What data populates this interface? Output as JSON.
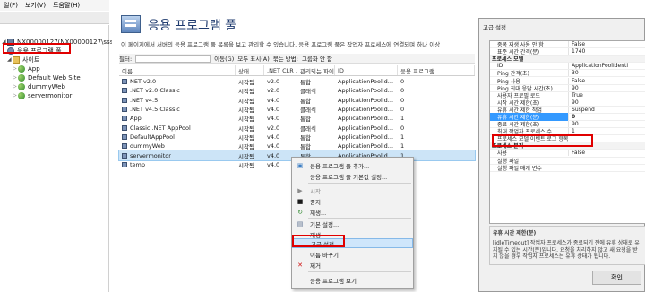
{
  "menu": [
    "일(F)",
    "보기(V)",
    "도움말(H)"
  ],
  "tree": {
    "server": "NX00000127(NX00000127\\sssss)",
    "app_pools": "응용 프로그램 풀",
    "sites": "사이트",
    "site_items": [
      "App",
      "Default Web Site",
      "dummyWeb",
      "servermonitor"
    ]
  },
  "center": {
    "title": "응용 프로그램 풀",
    "description": "이 페이지에서 서버의 응용 프로그램 풀 목록을 보고 관리할 수 있습니다. 응용 프로그램 풀은 작업자 프로세스에 연결되며 하나 이상",
    "filter_label": "필터:",
    "go_label": "이동(G)",
    "show_all_label": "모두 표시(A)",
    "group_label": "묶는 방법:",
    "group_value": "그룹화 안 함",
    "columns": [
      "이름",
      "상태",
      ".NET CLR ...",
      "관리되는 파이...",
      "ID",
      "응용 프로그램"
    ],
    "rows": [
      [
        "NET v2.0",
        "시작됨",
        "v2.0",
        "통합",
        "ApplicationPoolId...",
        "0"
      ],
      [
        ".NET v2.0 Classic",
        "시작됨",
        "v2.0",
        "클래식",
        "ApplicationPoolId...",
        "0"
      ],
      [
        ".NET v4.5",
        "시작됨",
        "v4.0",
        "통합",
        "ApplicationPoolId...",
        "0"
      ],
      [
        ".NET v4.5 Classic",
        "시작됨",
        "v4.0",
        "클래식",
        "ApplicationPoolId...",
        "0"
      ],
      [
        "App",
        "시작됨",
        "v4.0",
        "통합",
        "ApplicationPoolId...",
        "1"
      ],
      [
        "Classic .NET AppPool",
        "시작됨",
        "v2.0",
        "클래식",
        "ApplicationPoolId...",
        "0"
      ],
      [
        "DefaultAppPool",
        "시작됨",
        "v4.0",
        "통합",
        "ApplicationPoolId...",
        "1"
      ],
      [
        "dummyWeb",
        "시작됨",
        "v4.0",
        "통합",
        "ApplicationPoolId...",
        "1"
      ],
      [
        "servermonitor",
        "시작됨",
        "v4.0",
        "통합",
        "ApplicationPoolId...",
        "1"
      ],
      [
        "temp",
        "시작됨",
        "v4.0",
        "",
        "",
        ""
      ]
    ]
  },
  "context_menu": {
    "add_pool": "응용 프로그램 풀 추가...",
    "default_settings": "응용 프로그램 풀 기본값 설정...",
    "start": "시작",
    "stop": "중지",
    "recycle": "재생...",
    "basic_settings": "기본 설정...",
    "recycle2": "재생",
    "advanced_settings": "고급 설정...",
    "rename": "이름 바꾸기",
    "remove": "제거",
    "view_apps": "응용 프로그램 보기"
  },
  "dialog": {
    "title": "고급 설정",
    "properties": [
      {
        "name": "중복 재생 사용 안 함",
        "value": "False"
      },
      {
        "name": "표준 시간 간격(분)",
        "value": "1740"
      },
      {
        "name": "프로세스 모델",
        "value": "",
        "category": true
      },
      {
        "name": "ID",
        "value": "ApplicationPoolIdenti"
      },
      {
        "name": "Ping 간격(초)",
        "value": "30"
      },
      {
        "name": "Ping 사용",
        "value": "False"
      },
      {
        "name": "Ping 최대 응답 시간(초)",
        "value": "90"
      },
      {
        "name": "사용자 프로필 로드",
        "value": "True"
      },
      {
        "name": "시작 시간 제한(초)",
        "value": "90"
      },
      {
        "name": "유휴 시간 제한 작업",
        "value": "Suspend"
      },
      {
        "name": "유휴 시간 제한(분)",
        "value": "0",
        "selected": true
      },
      {
        "name": "종료 시간 제한(초)",
        "value": "90"
      },
      {
        "name": "최대 작업자 프로세스 수",
        "value": "1"
      },
      {
        "name": "프로세스 모델 이벤트 로그 항목",
        "value": ""
      },
      {
        "name": "프로세스 분리",
        "value": "",
        "category": true
      },
      {
        "name": "사용",
        "value": "False"
      },
      {
        "name": "실행 파일",
        "value": ""
      },
      {
        "name": "실행 파일 매개 변수",
        "value": ""
      }
    ],
    "help_title": "유휴 시간 제한(분)",
    "help_text": "[idleTimeout] 작업자 프로세스가 종료되기 전에 유휴 상태로 유지될 수 있는 시간(분)입니다. 요청을 처리하지 않고 새 요청을 받지 않을 경우 작업자 프로세스는 유휴 상태가 됩니다.",
    "ok_label": "확인"
  }
}
